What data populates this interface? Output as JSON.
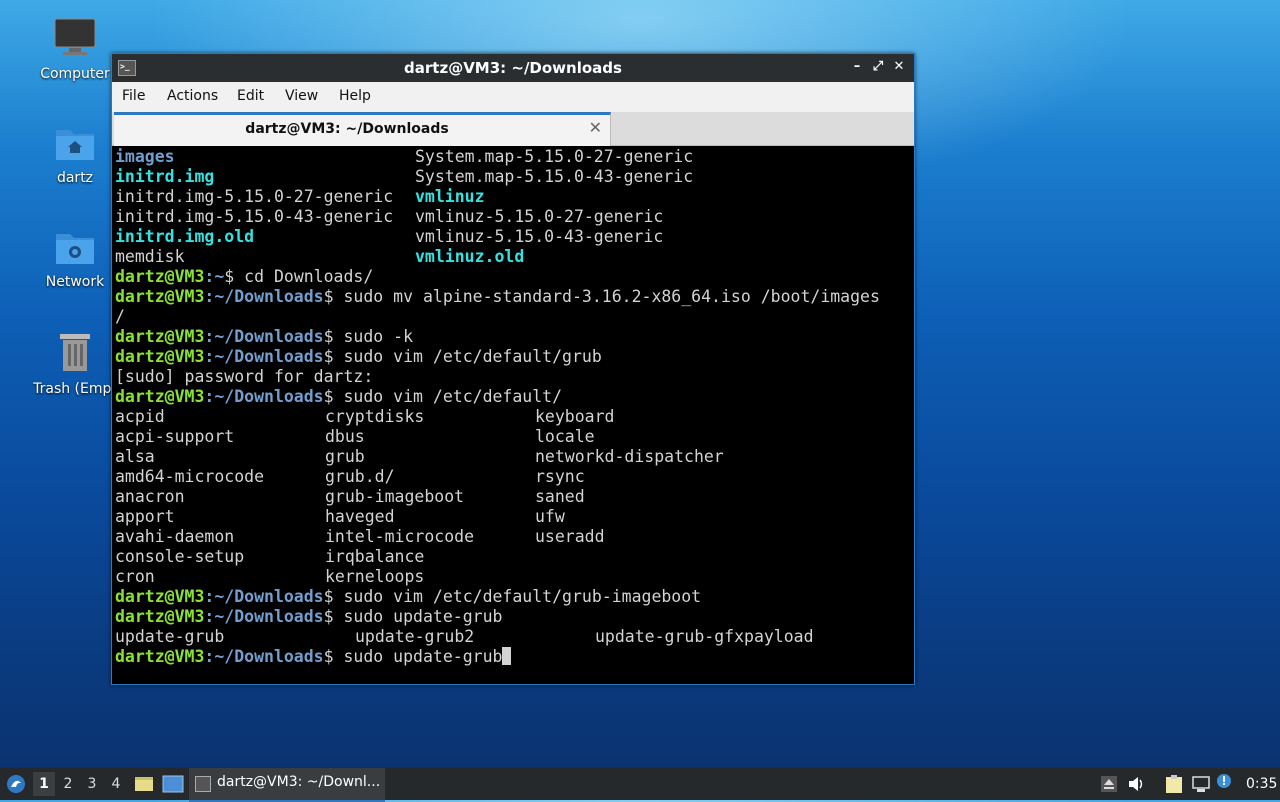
{
  "desktop": {
    "icons": [
      {
        "label": "Computer",
        "icon": "monitor-icon"
      },
      {
        "label": "dartz",
        "icon": "home-folder-icon"
      },
      {
        "label": "Network",
        "icon": "network-folder-icon"
      },
      {
        "label": "Trash (Empt",
        "icon": "trash-icon"
      }
    ]
  },
  "window": {
    "title": "dartz@VM3: ~/Downloads",
    "controls": {
      "minimize": "–",
      "maximize": "⤢",
      "close": "✕"
    },
    "menu": [
      "File",
      "Actions",
      "Edit",
      "View",
      "Help"
    ],
    "tab": {
      "label": "dartz@VM3: ~/Downloads",
      "close": "✕"
    }
  },
  "terminal": {
    "prompt_user": "dartz@VM3",
    "lines": [
      [
        "images",
        "System.map-5.15.0-27-generic"
      ],
      [
        "initrd.img",
        "System.map-5.15.0-43-generic"
      ],
      [
        "initrd.img-5.15.0-27-generic",
        "vmlinuz"
      ],
      [
        "initrd.img-5.15.0-43-generic",
        "vmlinuz-5.15.0-27-generic"
      ],
      [
        "initrd.img.old",
        "vmlinuz-5.15.0-43-generic"
      ],
      [
        "memdisk",
        "vmlinuz.old"
      ]
    ],
    "cmd1_path": ":~",
    "cmd1": "$ cd Downloads/",
    "dl_path": ":~/Downloads",
    "cmd2": "$ sudo mv alpine-standard-3.16.2-x86_64.iso /boot/images",
    "cmd2_wrap": "/",
    "cmd3": "$ sudo -k",
    "cmd4": "$ sudo vim /etc/default/grub",
    "sudo_prompt": "[sudo] password for dartz:",
    "cmd5": "$ sudo vim /etc/default/",
    "completion": [
      [
        "acpid",
        "cryptdisks",
        "keyboard"
      ],
      [
        "acpi-support",
        "dbus",
        "locale"
      ],
      [
        "alsa",
        "grub",
        "networkd-dispatcher"
      ],
      [
        "amd64-microcode",
        "grub.d/",
        "rsync"
      ],
      [
        "anacron",
        "grub-imageboot",
        "saned"
      ],
      [
        "apport",
        "haveged",
        "ufw"
      ],
      [
        "avahi-daemon",
        "intel-microcode",
        "useradd"
      ],
      [
        "console-setup",
        "irqbalance",
        ""
      ],
      [
        "cron",
        "kerneloops",
        ""
      ]
    ],
    "cmd6": "$ sudo vim /etc/default/grub-imageboot",
    "cmd7": "$ sudo update-grub",
    "update_completion": [
      "update-grub",
      "update-grub2",
      "update-grub-gfxpayload"
    ],
    "cmd8": "$ sudo update-grub"
  },
  "taskbar": {
    "workspaces": [
      "1",
      "2",
      "3",
      "4"
    ],
    "active_task": "dartz@VM3: ~/Downl...",
    "clock": "0:35"
  }
}
